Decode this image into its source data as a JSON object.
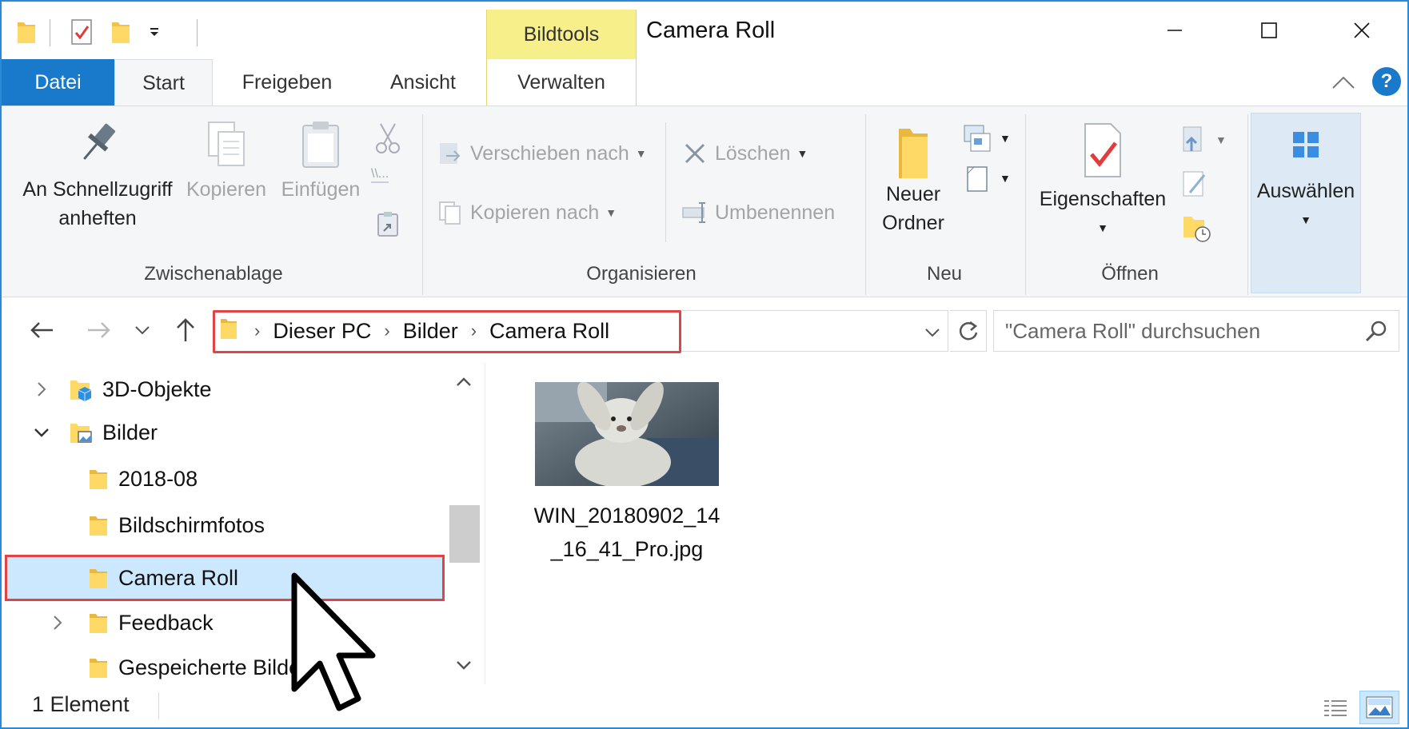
{
  "titlebar": {
    "contextual_tab": "Bildtools",
    "title": "Camera Roll"
  },
  "ribbon_tabs": {
    "file": "Datei",
    "start": "Start",
    "share": "Freigeben",
    "view": "Ansicht",
    "manage": "Verwalten"
  },
  "ribbon": {
    "clipboard": {
      "pin_label": "An Schnellzugriff\nanheften",
      "copy_label": "Kopieren",
      "paste_label": "Einfügen",
      "group_label": "Zwischenablage"
    },
    "organize": {
      "move_to": "Verschieben nach",
      "copy_to": "Kopieren nach",
      "delete": "Löschen",
      "rename": "Umbenennen",
      "group_label": "Organisieren"
    },
    "new": {
      "new_folder_label": "Neuer\nOrdner",
      "group_label": "Neu"
    },
    "open": {
      "properties_label": "Eigenschaften",
      "group_label": "Öffnen"
    },
    "select": {
      "select_label": "Auswählen"
    }
  },
  "address": {
    "crumbs": [
      "Dieser PC",
      "Bilder",
      "Camera Roll"
    ],
    "search_placeholder": "\"Camera Roll\" durchsuchen"
  },
  "tree": [
    {
      "label": "3D-Objekte",
      "expander": "collapsed",
      "level": 0
    },
    {
      "label": "Bilder",
      "expander": "expanded",
      "level": 0
    },
    {
      "label": "2018-08",
      "expander": "none",
      "level": 1
    },
    {
      "label": "Bildschirmfotos",
      "expander": "none",
      "level": 1
    },
    {
      "label": "Camera Roll",
      "expander": "none",
      "level": 1,
      "selected": true
    },
    {
      "label": "Feedback",
      "expander": "collapsed",
      "level": 1
    },
    {
      "label": "Gespeicherte Bilder",
      "expander": "none",
      "level": 1
    }
  ],
  "files": [
    {
      "name": "WIN_20180902_14_16_41_Pro.jpg"
    }
  ],
  "status": {
    "count": "1 Element"
  },
  "colors": {
    "accent": "#1979ca",
    "highlight_border": "#e04545",
    "selection": "#cce8ff",
    "contextual": "#f7f08a"
  }
}
